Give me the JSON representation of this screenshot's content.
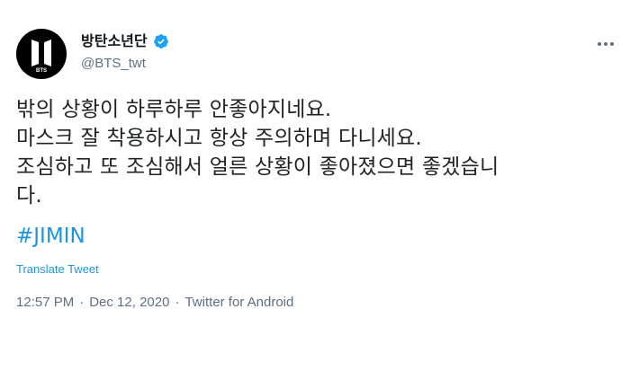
{
  "user": {
    "display_name": "방탄소년단",
    "handle": "@BTS_twt",
    "avatar_text": "BTS",
    "verified": true
  },
  "tweet": {
    "lines": [
      "밖의 상황이 하루하루 안좋아지네요.",
      "마스크 잘 착용하시고 항상 주의하며 다니세요.",
      "조심하고 또 조심해서 얼른 상황이 좋아졌으면 좋겠습니",
      "다."
    ],
    "hashtag": "#JIMIN",
    "translate_label": "Translate Tweet",
    "time": "12:57 PM",
    "separator": "·",
    "date": "Dec 12, 2020",
    "source": "Twitter for Android"
  },
  "colors": {
    "link": "#1b95e0",
    "verified": "#1da1f2",
    "secondary_text": "#5b7083"
  },
  "icons": {
    "more": "more-icon",
    "verified": "verified-badge-icon",
    "avatar": "bts-logo-icon"
  }
}
